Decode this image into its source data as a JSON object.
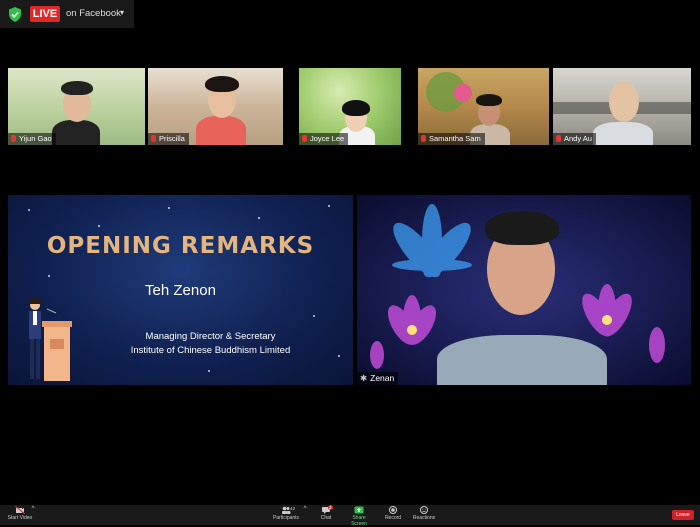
{
  "top": {
    "live_label": "LIVE",
    "platform_label": "on Facebook",
    "caret": "▾"
  },
  "participants": [
    {
      "name": "Yijun Gao"
    },
    {
      "name": "Priscilla"
    },
    {
      "name": "Joyce Lee"
    },
    {
      "name": "Samantha Sam"
    },
    {
      "name": "Andy Au"
    }
  ],
  "slide": {
    "title": "OPENING REMARKS",
    "speaker": "Teh Zenon",
    "role": "Managing Director & Secretary",
    "organization": "Institute of Chinese Buddhism Limited"
  },
  "active_speaker": {
    "name": "Zenan"
  },
  "toolbar": {
    "start_video": "Start Video",
    "participants": "Participants",
    "participants_count": "42",
    "chat": "Chat",
    "chat_badge": "3",
    "share_screen": "Share Screen",
    "record": "Record",
    "reactions": "Reactions",
    "leave": "Leave"
  },
  "colors": {
    "live_red": "#e02828",
    "share_green": "#2fbf4a",
    "leave_red": "#d0222a",
    "title_gold": "#e5b57f"
  }
}
